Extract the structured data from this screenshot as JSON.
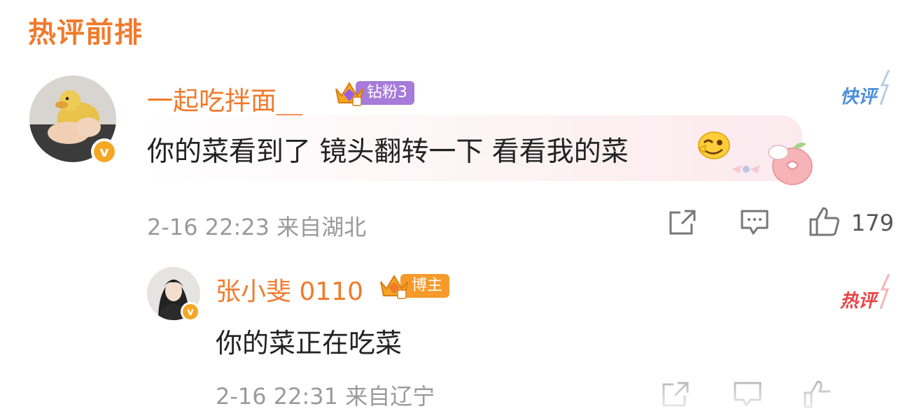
{
  "section_title": "热评前排",
  "main_comment": {
    "username": "一起吃拌面__",
    "badge": "钻粉3",
    "tag": "快评",
    "text": "你的菜看到了 镜头翻转一下 看看我的菜",
    "meta": "2-16 22:23 来自湖北",
    "like_count": "179",
    "icons": [
      "verified-icon",
      "share-icon",
      "comment-icon",
      "like-icon",
      "wink-emoji-icon"
    ],
    "colors": {
      "username": "#f07a2c",
      "badge": "#a77bd9",
      "tag": "#4d8fd9"
    }
  },
  "reply_comment": {
    "username": "张小斐 0110",
    "badge": "博主",
    "tag": "热评",
    "text": "你的菜正在吃菜",
    "meta": "2-16 22:31 来自辽宁",
    "colors": {
      "username": "#f07a2c",
      "badge": "#f59a2b",
      "tag": "#e64545"
    }
  }
}
